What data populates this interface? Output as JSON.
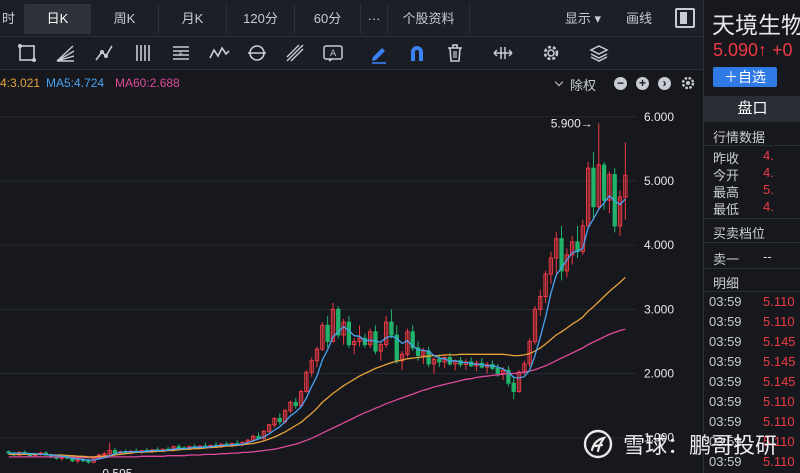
{
  "tabs": [
    {
      "label": "时",
      "active": false
    },
    {
      "label": "日K",
      "active": true
    },
    {
      "label": "周K",
      "active": false
    },
    {
      "label": "月K",
      "active": false
    },
    {
      "label": "120分",
      "active": false
    },
    {
      "label": "60分",
      "active": false
    },
    {
      "label": "···",
      "active": false
    },
    {
      "label": "个股资料",
      "active": false
    },
    {
      "label": "显示 ▾",
      "active": false
    },
    {
      "label": "画线",
      "active": false
    }
  ],
  "toolbar": {
    "icons": [
      "rectangle-tool-icon",
      "fan-tool-icon",
      "path-tool-icon",
      "parallel-lines-icon",
      "fibonacci-icon",
      "wave-icon",
      "cycle-icon",
      "gann-icon",
      "text-annotation-icon",
      "pen-icon",
      "magnet-icon",
      "trash-icon",
      "horizontal-resize-icon",
      "settings-icon",
      "layers-icon"
    ],
    "icon_colors": {
      "pen": "#3b82f6",
      "magnet": "#3b82f6"
    }
  },
  "ma_legend": {
    "ma_cut": "4:3.021",
    "ma5": "MA5:4.724",
    "ma60": "MA60:2.688",
    "colors": {
      "ma_cut": "#e8a23a",
      "ma5": "#4aa3f0",
      "ma60": "#e04a9e"
    }
  },
  "chuquan_label": "除权",
  "chart_data": {
    "type": "candlestick",
    "ylim": [
      0.59,
      6.2
    ],
    "y_ticks": [
      "6.000",
      "5.000",
      "4.000",
      "3.000",
      "2.000",
      "1.000"
    ],
    "y_tick_values": [
      6,
      5,
      4,
      3,
      2,
      1
    ],
    "annotations": [
      {
        "text": "5.900→",
        "value": 5.9
      },
      {
        "text": "←0.595",
        "value": 0.595
      }
    ],
    "up_color": "#ef3a45",
    "down_color": "#21b36b",
    "candles": [
      [
        0.78,
        0.8,
        0.74,
        0.76
      ],
      [
        0.76,
        0.78,
        0.72,
        0.73
      ],
      [
        0.73,
        0.79,
        0.71,
        0.77
      ],
      [
        0.77,
        0.8,
        0.74,
        0.75
      ],
      [
        0.75,
        0.77,
        0.71,
        0.72
      ],
      [
        0.72,
        0.76,
        0.7,
        0.74
      ],
      [
        0.74,
        0.78,
        0.72,
        0.76
      ],
      [
        0.76,
        0.79,
        0.72,
        0.73
      ],
      [
        0.73,
        0.75,
        0.68,
        0.7
      ],
      [
        0.7,
        0.73,
        0.66,
        0.68
      ],
      [
        0.68,
        0.72,
        0.64,
        0.7
      ],
      [
        0.7,
        0.74,
        0.67,
        0.68
      ],
      [
        0.68,
        0.71,
        0.62,
        0.64
      ],
      [
        0.64,
        0.69,
        0.6,
        0.66
      ],
      [
        0.66,
        0.7,
        0.62,
        0.64
      ],
      [
        0.64,
        0.67,
        0.595,
        0.62
      ],
      [
        0.62,
        0.7,
        0.6,
        0.68
      ],
      [
        0.68,
        0.75,
        0.66,
        0.73
      ],
      [
        0.73,
        0.78,
        0.7,
        0.75
      ],
      [
        0.75,
        0.92,
        0.73,
        0.8
      ],
      [
        0.8,
        0.84,
        0.74,
        0.76
      ],
      [
        0.76,
        0.8,
        0.73,
        0.78
      ],
      [
        0.78,
        0.82,
        0.75,
        0.77
      ],
      [
        0.77,
        0.8,
        0.74,
        0.79
      ],
      [
        0.79,
        0.83,
        0.76,
        0.78
      ],
      [
        0.78,
        0.81,
        0.75,
        0.8
      ],
      [
        0.8,
        0.84,
        0.77,
        0.79
      ],
      [
        0.79,
        0.82,
        0.76,
        0.81
      ],
      [
        0.81,
        0.85,
        0.78,
        0.8
      ],
      [
        0.8,
        0.83,
        0.77,
        0.82
      ],
      [
        0.82,
        0.86,
        0.79,
        0.81
      ],
      [
        0.81,
        0.88,
        0.79,
        0.86
      ],
      [
        0.86,
        0.9,
        0.82,
        0.84
      ],
      [
        0.84,
        0.87,
        0.8,
        0.83
      ],
      [
        0.83,
        0.88,
        0.81,
        0.86
      ],
      [
        0.86,
        0.9,
        0.83,
        0.85
      ],
      [
        0.85,
        0.88,
        0.82,
        0.87
      ],
      [
        0.87,
        0.92,
        0.84,
        0.86
      ],
      [
        0.86,
        0.89,
        0.83,
        0.88
      ],
      [
        0.88,
        0.93,
        0.85,
        0.87
      ],
      [
        0.87,
        0.91,
        0.84,
        0.9
      ],
      [
        0.9,
        0.94,
        0.86,
        0.88
      ],
      [
        0.88,
        0.92,
        0.85,
        0.91
      ],
      [
        0.91,
        0.96,
        0.88,
        0.9
      ],
      [
        0.9,
        0.94,
        0.87,
        0.93
      ],
      [
        0.93,
        0.98,
        0.9,
        0.96
      ],
      [
        0.96,
        1.05,
        0.93,
        1.02
      ],
      [
        1.02,
        1.08,
        0.97,
        0.99
      ],
      [
        0.99,
        1.12,
        0.96,
        1.1
      ],
      [
        1.1,
        1.22,
        1.06,
        1.2
      ],
      [
        1.2,
        1.32,
        1.16,
        1.3
      ],
      [
        1.3,
        1.38,
        1.2,
        1.25
      ],
      [
        1.25,
        1.45,
        1.22,
        1.42
      ],
      [
        1.42,
        1.58,
        1.38,
        1.55
      ],
      [
        1.55,
        1.62,
        1.45,
        1.5
      ],
      [
        1.5,
        1.75,
        1.47,
        1.72
      ],
      [
        1.72,
        2.05,
        1.7,
        2.02
      ],
      [
        2.02,
        2.25,
        1.95,
        2.2
      ],
      [
        2.2,
        2.42,
        2.1,
        2.38
      ],
      [
        2.38,
        2.8,
        2.35,
        2.75
      ],
      [
        2.75,
        2.9,
        2.4,
        2.5
      ],
      [
        2.5,
        3.1,
        2.48,
        3.0
      ],
      [
        3.0,
        3.05,
        2.55,
        2.6
      ],
      [
        2.6,
        2.85,
        2.45,
        2.8
      ],
      [
        2.8,
        2.9,
        2.4,
        2.45
      ],
      [
        2.45,
        2.55,
        2.3,
        2.5
      ],
      [
        2.5,
        2.75,
        2.42,
        2.55
      ],
      [
        2.55,
        2.62,
        2.4,
        2.45
      ],
      [
        2.45,
        2.7,
        2.4,
        2.65
      ],
      [
        2.65,
        2.75,
        2.3,
        2.35
      ],
      [
        2.35,
        2.5,
        2.2,
        2.45
      ],
      [
        2.45,
        2.9,
        2.4,
        2.8
      ],
      [
        2.8,
        3.0,
        2.55,
        2.6
      ],
      [
        2.6,
        2.75,
        2.15,
        2.2
      ],
      [
        2.2,
        2.35,
        2.05,
        2.3
      ],
      [
        2.3,
        2.7,
        2.25,
        2.65
      ],
      [
        2.65,
        2.75,
        2.35,
        2.4
      ],
      [
        2.4,
        2.5,
        2.2,
        2.28
      ],
      [
        2.28,
        2.4,
        2.15,
        2.35
      ],
      [
        2.35,
        2.42,
        2.1,
        2.15
      ],
      [
        2.15,
        2.25,
        2.0,
        2.22
      ],
      [
        2.22,
        2.3,
        2.1,
        2.18
      ],
      [
        2.18,
        2.28,
        2.08,
        2.25
      ],
      [
        2.25,
        2.32,
        2.12,
        2.15
      ],
      [
        2.15,
        2.22,
        2.05,
        2.2
      ],
      [
        2.2,
        2.26,
        2.1,
        2.14
      ],
      [
        2.14,
        2.22,
        2.06,
        2.18
      ],
      [
        2.18,
        2.25,
        2.1,
        2.12
      ],
      [
        2.12,
        2.2,
        2.04,
        2.16
      ],
      [
        2.16,
        2.24,
        2.08,
        2.1
      ],
      [
        2.1,
        2.18,
        2.0,
        2.14
      ],
      [
        2.14,
        2.2,
        2.05,
        2.08
      ],
      [
        2.08,
        2.15,
        1.95,
        2.0
      ],
      [
        2.0,
        2.1,
        1.9,
        2.05
      ],
      [
        2.05,
        2.12,
        1.8,
        1.85
      ],
      [
        1.85,
        1.95,
        1.6,
        1.72
      ],
      [
        1.72,
        2.05,
        1.7,
        2.02
      ],
      [
        2.02,
        2.2,
        1.98,
        2.15
      ],
      [
        2.15,
        2.55,
        2.1,
        2.5
      ],
      [
        2.5,
        3.05,
        2.45,
        3.0
      ],
      [
        3.0,
        3.3,
        2.9,
        3.2
      ],
      [
        3.2,
        3.6,
        3.1,
        3.55
      ],
      [
        3.55,
        3.9,
        3.4,
        3.8
      ],
      [
        3.8,
        4.2,
        3.55,
        4.1
      ],
      [
        4.1,
        4.3,
        3.45,
        3.6
      ],
      [
        3.6,
        3.95,
        3.5,
        3.85
      ],
      [
        3.85,
        4.15,
        3.7,
        4.05
      ],
      [
        4.05,
        4.3,
        3.8,
        3.9
      ],
      [
        3.9,
        4.4,
        3.85,
        4.3
      ],
      [
        4.3,
        5.3,
        4.25,
        5.2
      ],
      [
        5.2,
        5.45,
        4.4,
        4.6
      ],
      [
        4.6,
        5.9,
        4.55,
        5.25
      ],
      [
        5.25,
        5.3,
        4.55,
        4.7
      ],
      [
        4.7,
        5.15,
        4.5,
        5.1
      ],
      [
        5.1,
        5.2,
        4.2,
        4.3
      ],
      [
        4.3,
        4.85,
        4.15,
        4.75
      ],
      [
        4.75,
        5.6,
        4.4,
        5.09
      ]
    ],
    "ma_a": [
      0.74,
      0.74,
      0.74,
      0.74,
      0.74,
      0.74,
      0.74,
      0.74,
      0.73,
      0.73,
      0.73,
      0.72,
      0.72,
      0.71,
      0.71,
      0.7,
      0.7,
      0.71,
      0.71,
      0.72,
      0.73,
      0.74,
      0.75,
      0.76,
      0.77,
      0.77,
      0.78,
      0.78,
      0.79,
      0.79,
      0.8,
      0.8,
      0.81,
      0.82,
      0.82,
      0.83,
      0.83,
      0.84,
      0.85,
      0.85,
      0.86,
      0.87,
      0.87,
      0.88,
      0.89,
      0.9,
      0.91,
      0.93,
      0.95,
      0.98,
      1.01,
      1.05,
      1.09,
      1.14,
      1.19,
      1.24,
      1.31,
      1.38,
      1.46,
      1.55,
      1.62,
      1.69,
      1.75,
      1.81,
      1.86,
      1.91,
      1.96,
      2.0,
      2.04,
      2.08,
      2.11,
      2.14,
      2.17,
      2.19,
      2.21,
      2.23,
      2.24,
      2.25,
      2.26,
      2.27,
      2.28,
      2.28,
      2.29,
      2.29,
      2.29,
      2.3,
      2.3,
      2.3,
      2.3,
      2.3,
      2.3,
      2.3,
      2.3,
      2.3,
      2.29,
      2.28,
      2.28,
      2.29,
      2.31,
      2.35,
      2.4,
      2.46,
      2.53,
      2.6,
      2.65,
      2.71,
      2.77,
      2.82,
      2.88,
      2.97,
      3.04,
      3.12,
      3.2,
      3.28,
      3.35,
      3.42,
      3.5
    ],
    "ma5": [
      0.76,
      0.76,
      0.76,
      0.76,
      0.75,
      0.75,
      0.74,
      0.74,
      0.73,
      0.72,
      0.71,
      0.7,
      0.68,
      0.67,
      0.66,
      0.65,
      0.65,
      0.67,
      0.69,
      0.72,
      0.75,
      0.77,
      0.78,
      0.78,
      0.78,
      0.78,
      0.79,
      0.8,
      0.8,
      0.8,
      0.81,
      0.82,
      0.83,
      0.83,
      0.84,
      0.85,
      0.85,
      0.85,
      0.86,
      0.87,
      0.88,
      0.88,
      0.89,
      0.89,
      0.9,
      0.92,
      0.95,
      0.98,
      1.01,
      1.06,
      1.12,
      1.17,
      1.25,
      1.34,
      1.4,
      1.48,
      1.62,
      1.8,
      1.96,
      2.21,
      2.37,
      2.57,
      2.65,
      2.73,
      2.67,
      2.59,
      2.58,
      2.51,
      2.52,
      2.5,
      2.49,
      2.56,
      2.58,
      2.55,
      2.47,
      2.51,
      2.43,
      2.37,
      2.36,
      2.35,
      2.28,
      2.24,
      2.23,
      2.19,
      2.2,
      2.18,
      2.17,
      2.16,
      2.14,
      2.14,
      2.12,
      2.12,
      2.1,
      2.07,
      2.02,
      1.94,
      1.93,
      1.95,
      2.05,
      2.28,
      2.57,
      2.88,
      3.25,
      3.53,
      3.65,
      3.77,
      3.88,
      3.91,
      3.95,
      4.27,
      4.41,
      4.56,
      4.66,
      4.77,
      4.69,
      4.63,
      4.72
    ],
    "ma60": [
      0.7,
      0.7,
      0.7,
      0.7,
      0.7,
      0.7,
      0.7,
      0.7,
      0.7,
      0.7,
      0.7,
      0.7,
      0.7,
      0.69,
      0.69,
      0.69,
      0.69,
      0.69,
      0.69,
      0.7,
      0.7,
      0.7,
      0.7,
      0.7,
      0.7,
      0.71,
      0.71,
      0.71,
      0.71,
      0.71,
      0.72,
      0.72,
      0.72,
      0.72,
      0.73,
      0.73,
      0.73,
      0.74,
      0.74,
      0.74,
      0.75,
      0.75,
      0.76,
      0.76,
      0.77,
      0.77,
      0.78,
      0.79,
      0.8,
      0.81,
      0.82,
      0.84,
      0.86,
      0.88,
      0.9,
      0.93,
      0.96,
      0.99,
      1.03,
      1.07,
      1.11,
      1.15,
      1.19,
      1.23,
      1.27,
      1.31,
      1.35,
      1.39,
      1.42,
      1.46,
      1.49,
      1.53,
      1.56,
      1.59,
      1.62,
      1.65,
      1.68,
      1.71,
      1.74,
      1.76,
      1.79,
      1.81,
      1.83,
      1.85,
      1.87,
      1.89,
      1.91,
      1.92,
      1.94,
      1.95,
      1.96,
      1.97,
      1.98,
      1.99,
      2.0,
      2.0,
      2.01,
      2.02,
      2.04,
      2.06,
      2.09,
      2.12,
      2.16,
      2.2,
      2.24,
      2.28,
      2.32,
      2.36,
      2.4,
      2.45,
      2.49,
      2.53,
      2.57,
      2.61,
      2.64,
      2.67,
      2.69
    ]
  },
  "panel": {
    "stock_name": "天境生物",
    "price": "5.090↑ +0",
    "add_watch": "＋自选",
    "pankou_tab": "盘口",
    "market_data_title": "行情数据",
    "quotes": [
      {
        "label": "昨收",
        "value": "4."
      },
      {
        "label": "今开",
        "value": "4."
      },
      {
        "label": "最高",
        "value": "5."
      },
      {
        "label": "最低",
        "value": "4."
      }
    ],
    "order_book_title": "买卖档位",
    "sell1_label": "卖一",
    "sell1_value": "--",
    "detail_title": "明细",
    "trades": [
      {
        "time": "03:59",
        "price": "5.110"
      },
      {
        "time": "03:59",
        "price": "5.110"
      },
      {
        "time": "03:59",
        "price": "5.145"
      },
      {
        "time": "03:59",
        "price": "5.145"
      },
      {
        "time": "03:59",
        "price": "5.145"
      },
      {
        "time": "03:59",
        "price": "5.110"
      },
      {
        "time": "03:59",
        "price": "5.110"
      },
      {
        "time": "03:59",
        "price": "5.110"
      },
      {
        "time": "03:59",
        "price": "5.110"
      }
    ]
  },
  "watermark": {
    "text": "雪球：鹏哥投研"
  }
}
